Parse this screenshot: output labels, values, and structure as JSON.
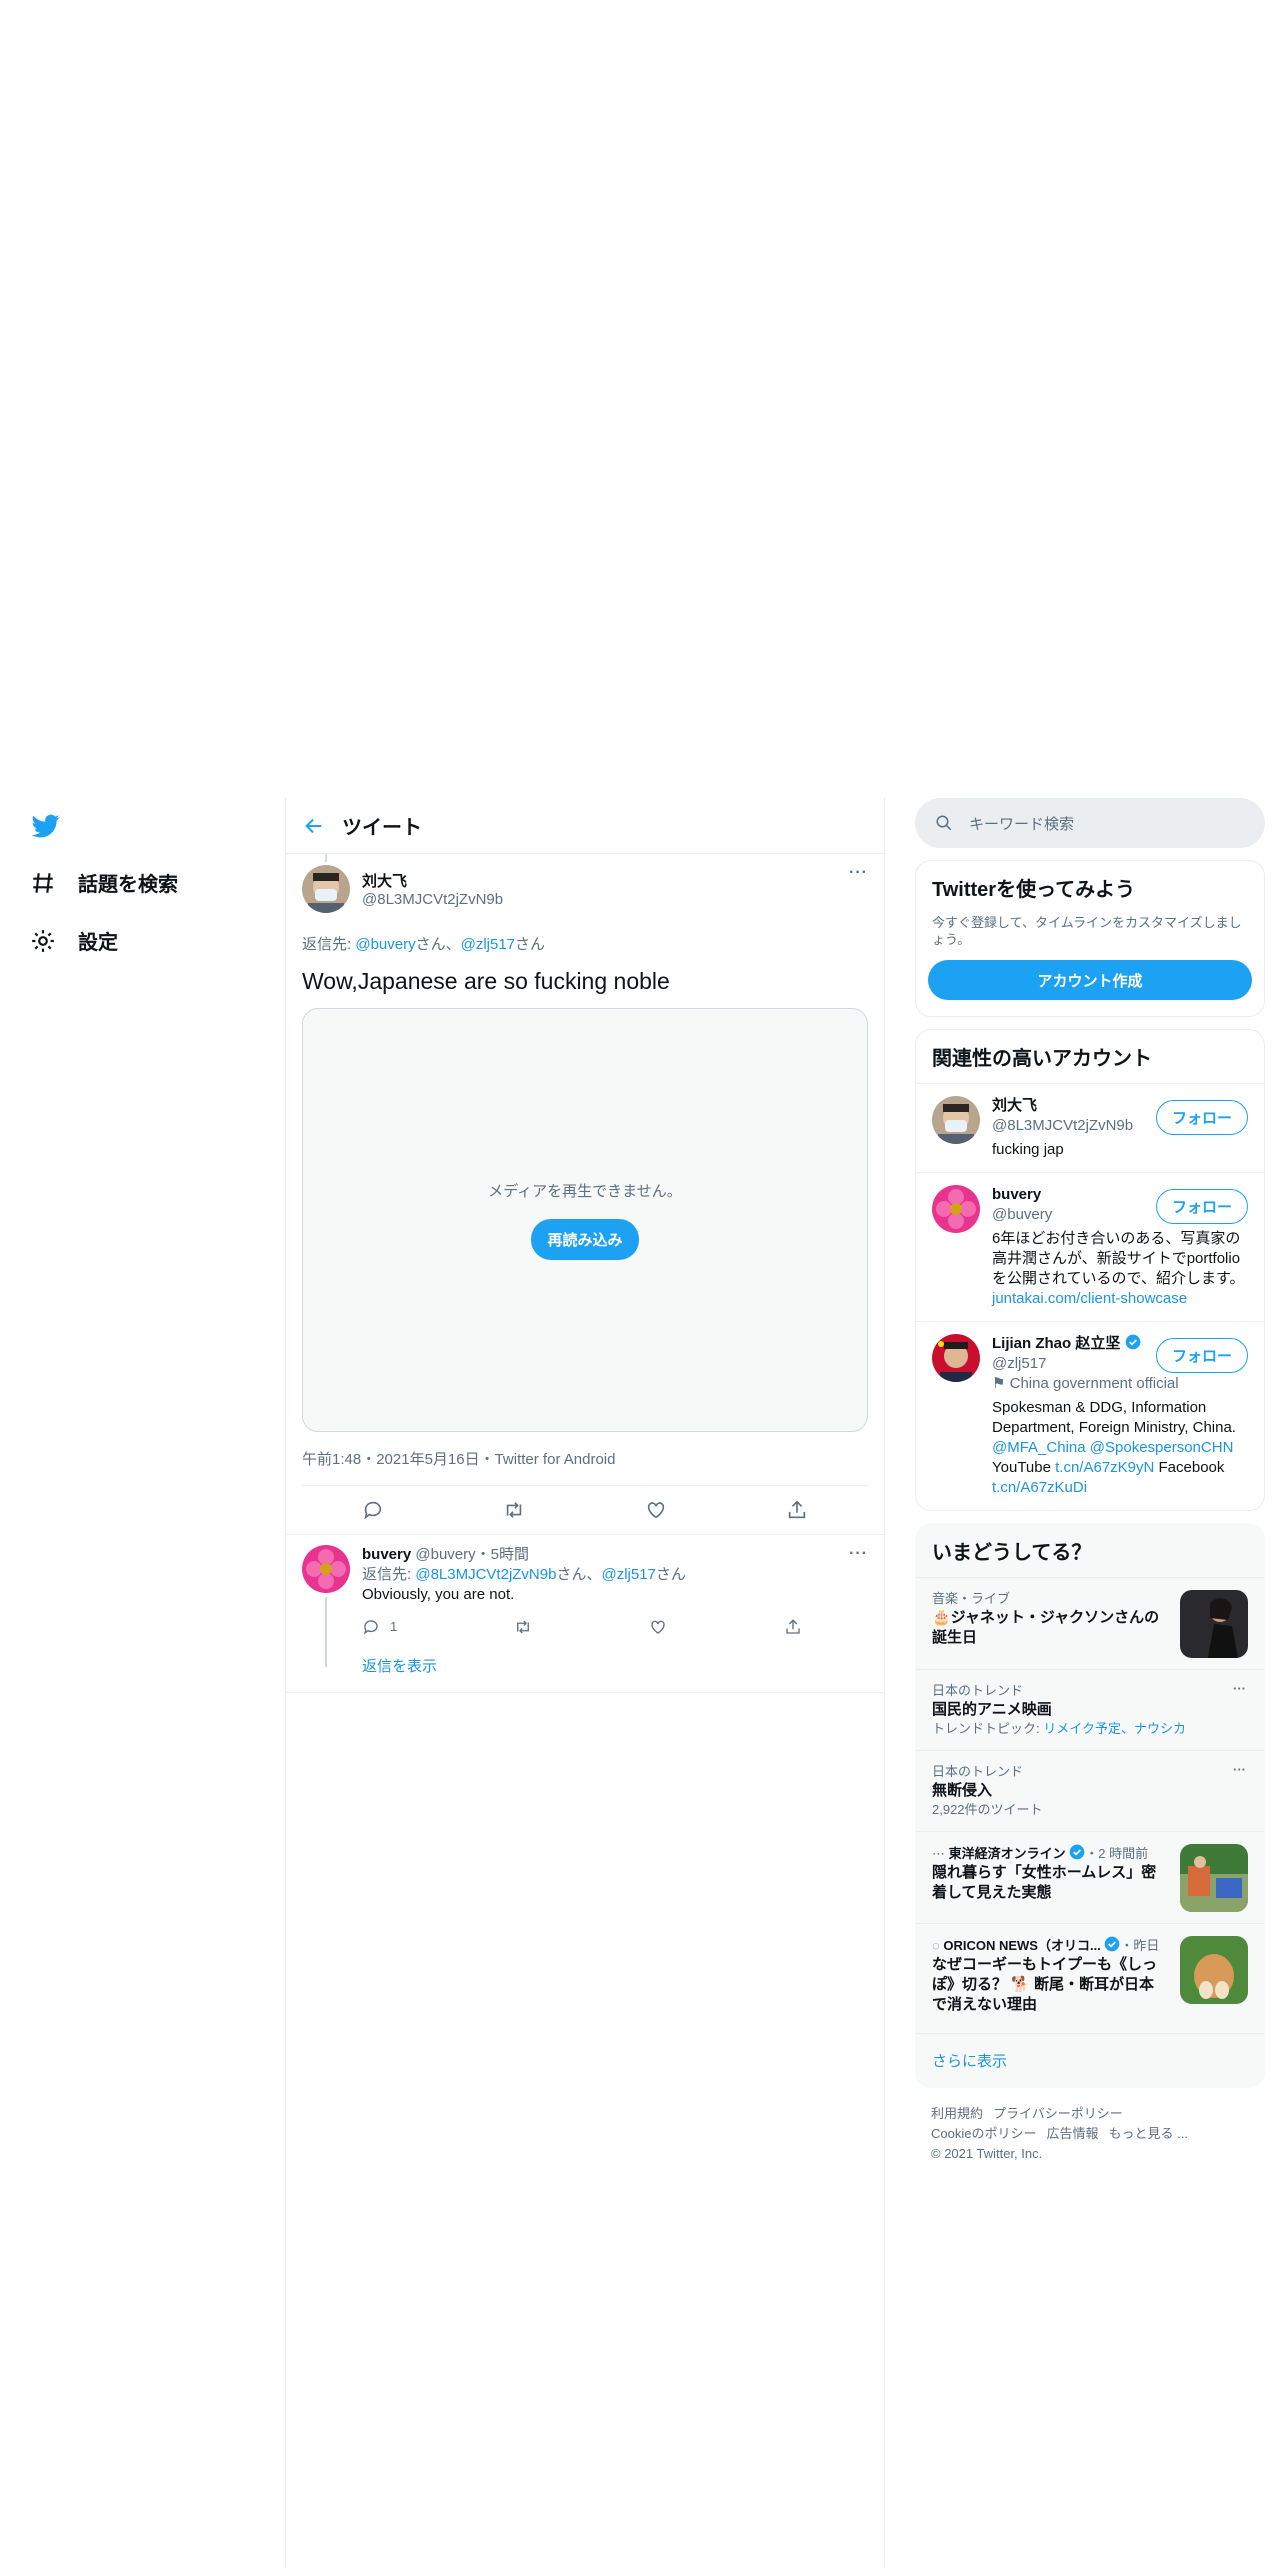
{
  "nav": {
    "items": [
      {
        "label": "話題を検索",
        "icon": "hashtag-icon"
      },
      {
        "label": "設定",
        "icon": "gear-icon"
      }
    ]
  },
  "header": {
    "title": "ツイート"
  },
  "tweet": {
    "author_name": "刘大飞",
    "author_handle": "@8L3MJCVt2jZvN9b",
    "reply_prefix": "返信先: ",
    "reply_user1": "@buvery",
    "reply_sep": "さん、",
    "reply_user2": "@zlj517",
    "reply_suffix": "さん",
    "text": "Wow,Japanese are so fucking noble",
    "media_message": "メディアを再生できません。",
    "reload_label": "再読み込み",
    "meta": "午前1:48・2021年5月16日・Twitter for Android"
  },
  "reply": {
    "author_name": "buvery",
    "author_handle": "@buvery",
    "time": "・5時間",
    "reply_prefix": "返信先: ",
    "reply_user1": "@8L3MJCVt2jZvN9b",
    "reply_sep": "さん、",
    "reply_user2": "@zlj517",
    "reply_suffix": "さん",
    "text": "Obviously, you are not.",
    "reply_count": "1",
    "show_replies": "返信を表示"
  },
  "search": {
    "placeholder": "キーワード検索"
  },
  "signup": {
    "title": "Twitterを使ってみよう",
    "subtitle": "今すぐ登録して、タイムラインをカスタマイズしましょう。",
    "button": "アカウント作成"
  },
  "related": {
    "title": "関連性の高いアカウント",
    "follow_label": "フォロー",
    "accounts": [
      {
        "name": "刘大飞",
        "handle": "@8L3MJCVt2jZvN9b",
        "bio": "fucking jap"
      },
      {
        "name": "buvery",
        "handle": "@buvery",
        "bio": "6年ほどお付き合いのある、写真家の高井潤さんが、新設サイトでportfolioを公開されているので、紹介します。",
        "link": "juntakai.com/client-showcase"
      },
      {
        "name": "Lijian Zhao 赵立坚",
        "handle": "@zlj517",
        "label": "China government official",
        "bio": "Spokesman & DDG, Information Department, Foreign Ministry, China.",
        "mention1": "@MFA_China",
        "mention2": "@SpokespersonCHN",
        "yt_label": "YouTube ",
        "yt_link": "t.cn/A67zK9yN",
        "fb_label": " Facebook ",
        "fb_link": "t.cn/A67zKuDi"
      }
    ]
  },
  "trends": {
    "title": "いまどうしてる？",
    "items": [
      {
        "context": "音楽・ライブ",
        "title": "🎂ジャネット・ジャクソンさんの誕生日"
      },
      {
        "context": "日本のトレンド",
        "title": "国民的アニメ映画",
        "sub_prefix": "トレンドトピック: ",
        "sub_link": "リメイク予定、ナウシカ"
      },
      {
        "context": "日本のトレンド",
        "title": "無断侵入",
        "sub": "2,922件のツイート"
      },
      {
        "source": "東洋経済オンライン",
        "time": "・2 時間前",
        "title": "隠れ暮らす「女性ホームレス」密着して見えた実態"
      },
      {
        "source": "ORICON NEWS（オリコ...",
        "time": "・昨日",
        "title": "なぜコーギーもトイプーも《しっぽ》切る？ 🐕 断尾・断耳が日本で消えない理由"
      }
    ],
    "show_more": "さらに表示"
  },
  "footer": {
    "links": [
      "利用規約",
      "プライバシーポリシー",
      "Cookieのポリシー",
      "広告情報",
      "もっと見る ..."
    ],
    "copyright": "© 2021 Twitter, Inc."
  },
  "colors": {
    "accent": "#1da1f2",
    "link": "#1b95e0",
    "secondary_text": "#5b7083"
  }
}
